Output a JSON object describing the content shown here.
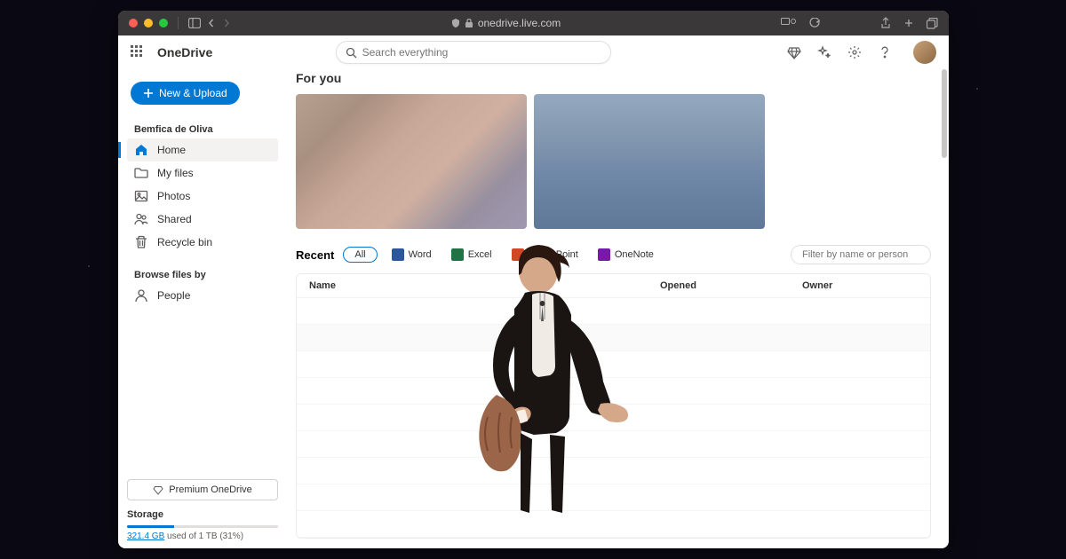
{
  "browser": {
    "url": "onedrive.live.com"
  },
  "header": {
    "brand": "OneDrive",
    "search_placeholder": "Search everything"
  },
  "sidebar": {
    "new_button": "New & Upload",
    "user_section": "Bemfica de Oliva",
    "items": [
      {
        "label": "Home",
        "icon": "home"
      },
      {
        "label": "My files",
        "icon": "folder"
      },
      {
        "label": "Photos",
        "icon": "photo"
      },
      {
        "label": "Shared",
        "icon": "people"
      },
      {
        "label": "Recycle bin",
        "icon": "trash"
      }
    ],
    "browse_section": "Browse files by",
    "browse_items": [
      {
        "label": "People",
        "icon": "person"
      }
    ],
    "premium": "Premium OneDrive",
    "storage": {
      "title": "Storage",
      "used": "321.4 GB",
      "total_text": "used of 1 TB (31%)",
      "percent": 31
    }
  },
  "main": {
    "for_you": "For you",
    "recent": "Recent",
    "filters": {
      "all": "All",
      "word": "Word",
      "excel": "Excel",
      "powerpoint": "PowerPoint",
      "onenote": "OneNote"
    },
    "filter_placeholder": "Filter by name or person",
    "columns": {
      "name": "Name",
      "opened": "Opened",
      "owner": "Owner"
    }
  }
}
